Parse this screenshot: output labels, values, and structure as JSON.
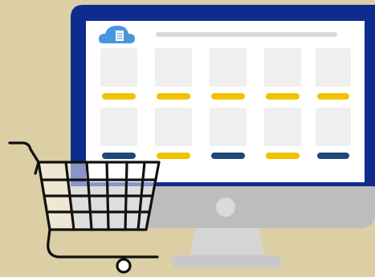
{
  "colors": {
    "background": "#DCCFA6",
    "monitor_frame": "#0E2C8E",
    "screen": "#FFFFFF",
    "monitor_chin": "#BDBDBD",
    "stand": "#D5D5D5",
    "tile": "#EFEFEF",
    "search_bar": "#D8D8D8",
    "price_yellow": "#F2C200",
    "price_navy": "#1F4778",
    "cloud": "#4A96DE",
    "cart": "#111111"
  },
  "icons": {
    "logo": "cloud-server-icon",
    "cart": "shopping-cart-icon",
    "power": "power-button-icon"
  },
  "product_grid": {
    "rows": [
      {
        "row": 1,
        "bar_colors": [
          "yellow",
          "yellow",
          "yellow",
          "yellow",
          "yellow"
        ]
      },
      {
        "row": 2,
        "bar_colors": [
          "navy",
          "yellow",
          "navy",
          "yellow",
          "navy"
        ]
      }
    ]
  }
}
